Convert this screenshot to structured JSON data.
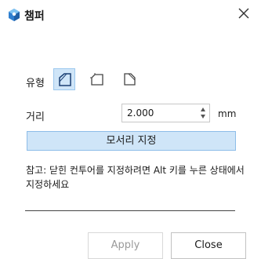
{
  "window": {
    "title": "챔퍼",
    "close_icon": "close-icon"
  },
  "form": {
    "type_label": "유형",
    "type_options": [
      {
        "icon": "chamfer-equal-distance-icon",
        "selected": true
      },
      {
        "icon": "chamfer-two-distance-icon",
        "selected": false
      },
      {
        "icon": "chamfer-distance-angle-icon",
        "selected": false
      }
    ],
    "distance_label": "거리",
    "distance_value": "2.000",
    "distance_unit": "mm",
    "edge_select_label": "모서리 지정",
    "note": "참고: 닫힌 컨투어를 지정하려면 Alt 키를 누른 상태에서 지정하세요"
  },
  "footer": {
    "apply_label": "Apply",
    "close_label": "Close"
  },
  "colors": {
    "accent_fill": "#cfe5f8",
    "accent_border": "#8dbde8",
    "disabled_text": "#9a9a9a"
  }
}
